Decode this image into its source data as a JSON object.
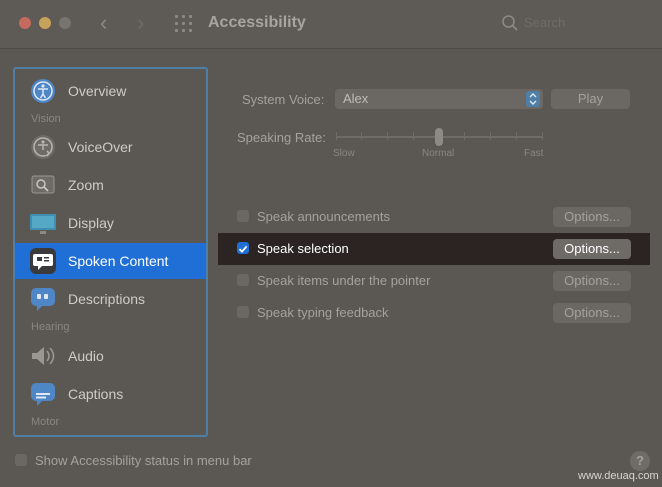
{
  "window": {
    "title": "Accessibility",
    "search_placeholder": "Search"
  },
  "sidebar": {
    "items": [
      {
        "label": "Overview",
        "icon": "accessibility-icon",
        "selected": false
      },
      {
        "label": "VoiceOver",
        "icon": "voiceover-icon",
        "selected": false
      },
      {
        "label": "Zoom",
        "icon": "zoom-icon",
        "selected": false
      },
      {
        "label": "Display",
        "icon": "display-icon",
        "selected": false
      },
      {
        "label": "Spoken Content",
        "icon": "spoken-content-icon",
        "selected": true
      },
      {
        "label": "Descriptions",
        "icon": "descriptions-icon",
        "selected": false
      },
      {
        "label": "Audio",
        "icon": "audio-icon",
        "selected": false
      },
      {
        "label": "Captions",
        "icon": "captions-icon",
        "selected": false
      }
    ],
    "sections": {
      "vision": "Vision",
      "hearing": "Hearing",
      "motor": "Motor"
    }
  },
  "main": {
    "system_voice": {
      "label": "System Voice:",
      "value": "Alex",
      "play_label": "Play"
    },
    "speaking_rate": {
      "label": "Speaking Rate:",
      "min_label": "Slow",
      "mid_label": "Normal",
      "max_label": "Fast",
      "value": 0.5
    },
    "options": [
      {
        "label": "Speak announcements",
        "checked": false,
        "button": "Options..."
      },
      {
        "label": "Speak selection",
        "checked": true,
        "button": "Options..."
      },
      {
        "label": "Speak items under the pointer",
        "checked": false,
        "button": "Options..."
      },
      {
        "label": "Speak typing feedback",
        "checked": false,
        "button": "Options..."
      }
    ]
  },
  "footer": {
    "status_label": "Show Accessibility status in menu bar",
    "status_checked": false,
    "help_label": "?"
  },
  "watermark": "www.deuaq.com",
  "colors": {
    "accent": "#1f6fd6",
    "focus_border": "#4f7ea6",
    "highlight_row": "#2c2423"
  }
}
